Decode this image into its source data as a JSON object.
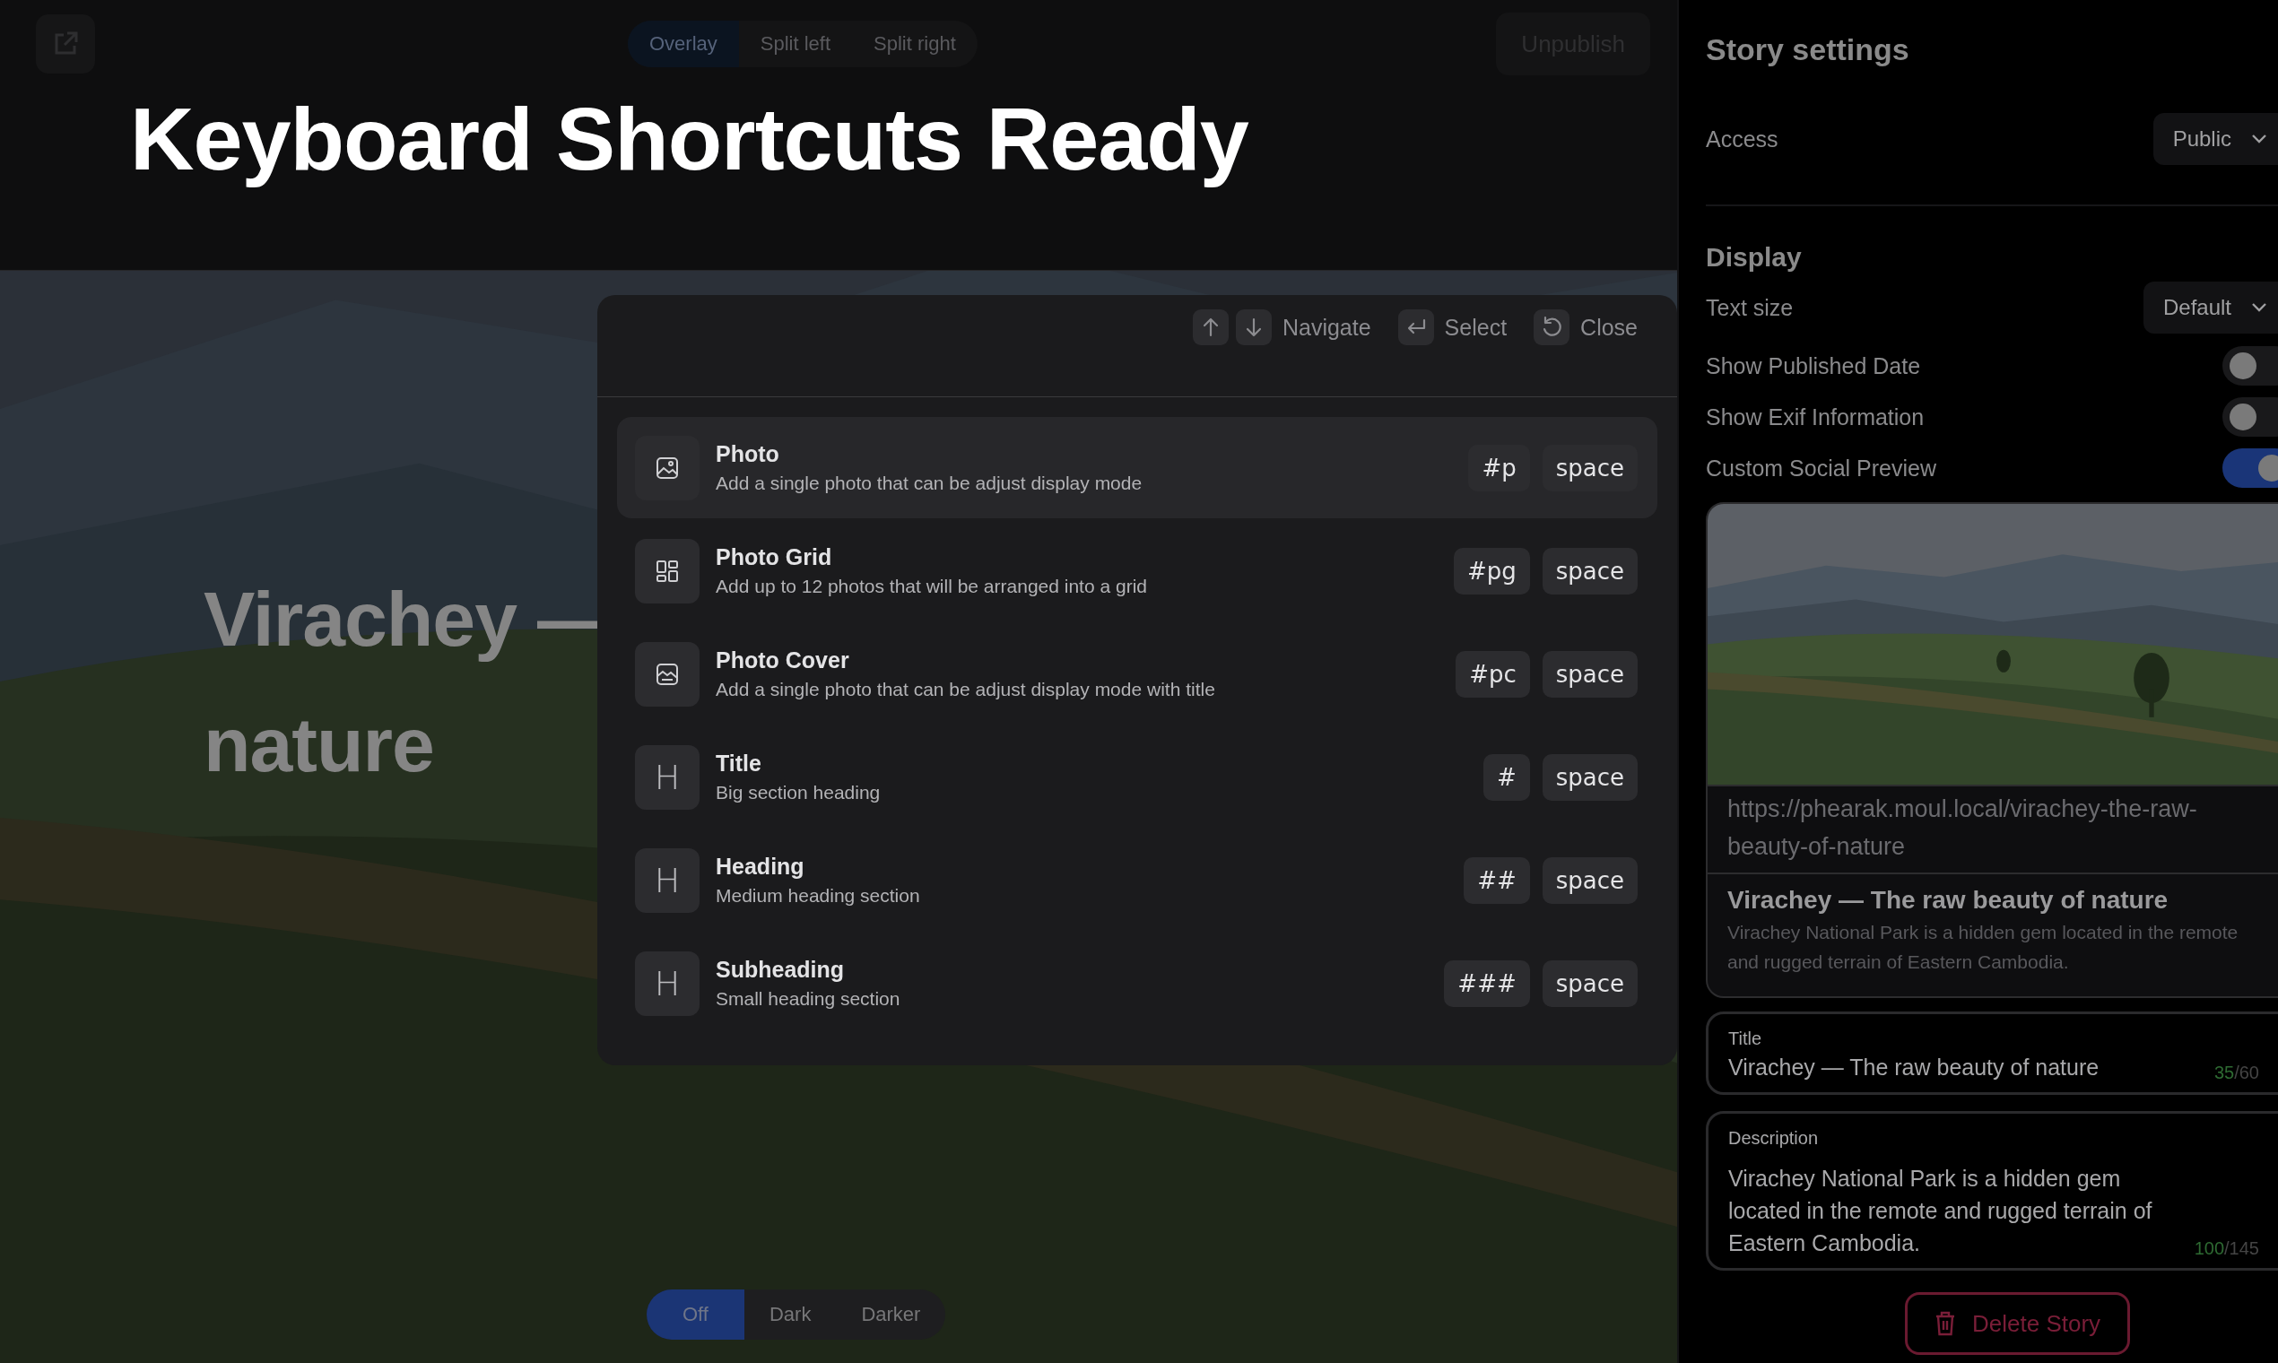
{
  "toolbar": {
    "view_modes": [
      {
        "label": "Overlay",
        "selected": true
      },
      {
        "label": "Split left",
        "selected": false
      },
      {
        "label": "Split right",
        "selected": false
      }
    ],
    "publish_button": "Unpublish"
  },
  "banner": {
    "title": "Keyboard Shortcuts Ready"
  },
  "story": {
    "headline_lines": [
      "Virachey —",
      "nature"
    ]
  },
  "command_menu": {
    "hints": [
      {
        "kind": "navigate",
        "label": "Navigate"
      },
      {
        "kind": "select",
        "label": "Select"
      },
      {
        "kind": "close",
        "label": "Close"
      }
    ],
    "items": [
      {
        "title": "Photo",
        "description": "Add a single photo that can be adjust display mode",
        "shortcut": "#p",
        "key": "space",
        "selected": true
      },
      {
        "kind": "grid",
        "title": "Photo Grid",
        "description": "Add up to 12 photos that will be arranged into a grid",
        "shortcut": "#pg",
        "key": "space",
        "selected": false
      },
      {
        "kind": "cover",
        "title": "Photo Cover",
        "description": "Add a single photo that can be adjust display mode with title",
        "shortcut": "#pc",
        "key": "space",
        "selected": false
      },
      {
        "kind": "letter",
        "icon_text": "H",
        "title": "Title",
        "description": "Big section heading",
        "shortcut": "#",
        "key": "space",
        "selected": false
      },
      {
        "kind": "letter",
        "icon_text": "H",
        "title": "Heading",
        "description": "Medium heading section",
        "shortcut": "##",
        "key": "space",
        "selected": false
      },
      {
        "kind": "letter",
        "icon_text": "H",
        "title": "Subheading",
        "description": "Small heading section",
        "shortcut": "###",
        "key": "space",
        "selected": false
      }
    ]
  },
  "dim_modes": [
    {
      "label": "Off",
      "selected": true
    },
    {
      "label": "Dark",
      "selected": false
    },
    {
      "label": "Darker",
      "selected": false
    }
  ],
  "settings": {
    "title": "Story settings",
    "access": {
      "label": "Access",
      "value": "Public"
    },
    "display": {
      "heading": "Display",
      "text_size": {
        "label": "Text size",
        "value": "Default"
      },
      "toggles": [
        {
          "label": "Show Published Date",
          "on": false
        },
        {
          "label": "Show Exif Information",
          "on": false
        },
        {
          "label": "Custom Social Preview",
          "on": true
        }
      ]
    },
    "preview": {
      "kind": "picture",
      "url": "https://phearak.moul.local/virachey-the-raw-beauty-of-nature",
      "title": "Virachey — The raw beauty of nature",
      "description": "Virachey National Park is a hidden gem located in the remote and rugged terrain of Eastern Cambodia."
    },
    "fields": [
      {
        "label": "Title",
        "value": "Virachey — The raw beauty of nature",
        "counter": {
          "used": "35",
          "limit": "/60"
        }
      },
      {
        "label": "Description",
        "value": "Virachey National Park is a hidden gem located in the remote and rugged terrain of Eastern Cambodia.",
        "counter": {
          "used": "100",
          "limit": "/145"
        }
      }
    ],
    "delete_button": "Delete Story"
  }
}
